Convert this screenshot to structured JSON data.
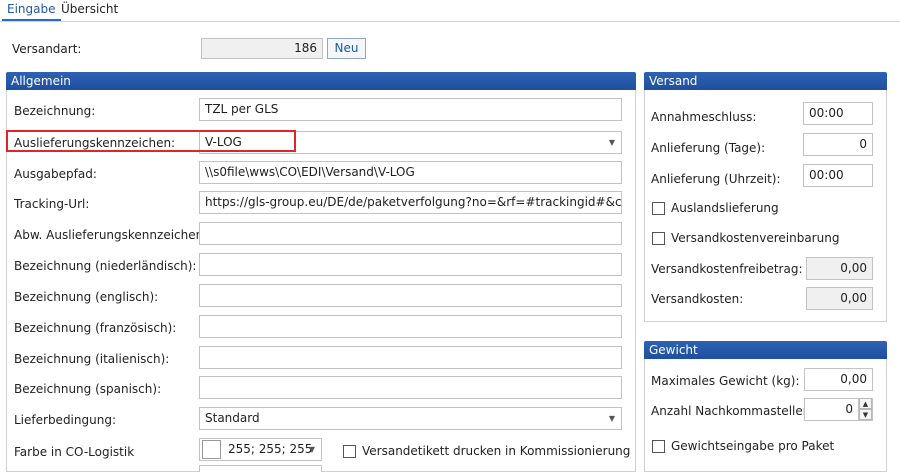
{
  "tabs": [
    {
      "label": "Eingabe"
    },
    {
      "label": "Übersicht"
    }
  ],
  "versandart": {
    "label": "Versandart:",
    "value": "186",
    "neu_button": "Neu"
  },
  "allgemein": {
    "header": "Allgemein",
    "rows": [
      {
        "label": "Bezeichnung:",
        "value": "TZL per GLS"
      },
      {
        "label": "Auslieferungskennzeichen:",
        "value": "V-LOG"
      },
      {
        "label": "Ausgabepfad:",
        "value": "\\\\s0file\\wws\\CO\\EDI\\Versand\\V-LOG"
      },
      {
        "label": "Tracking-Url:",
        "value": "https://gls-group.eu/DE/de/paketverfolgung?no=&rf=#trackingid#&crf=&l"
      },
      {
        "label": "Abw. Auslieferungskennzeichen:",
        "value": ""
      },
      {
        "label": "Bezeichnung (niederländisch):",
        "value": ""
      },
      {
        "label": "Bezeichnung (englisch):",
        "value": ""
      },
      {
        "label": "Bezeichnung (französisch):",
        "value": ""
      },
      {
        "label": "Bezeichnung (italienisch):",
        "value": ""
      },
      {
        "label": "Bezeichnung (spanisch):",
        "value": ""
      },
      {
        "label": "Lieferbedingung:",
        "value": "Standard"
      },
      {
        "label": "Farbe in CO-Logistik",
        "value": "255; 255; 255"
      }
    ],
    "versandetikett_label": "Versandetikett drucken in Kommissionierung"
  },
  "versand": {
    "header": "Versand",
    "annahmeschluss": {
      "label": "Annahmeschluss:",
      "value": "00:00"
    },
    "anlieferung_tage": {
      "label": "Anlieferung (Tage):",
      "value": "0"
    },
    "anlieferung_uhrzeit": {
      "label": "Anlieferung (Uhrzeit):",
      "value": "00:00"
    },
    "auslandslieferung": {
      "label": "Auslandslieferung",
      "checked": false
    },
    "versandkostenvereinbarung": {
      "label": "Versandkostenvereinbarung",
      "checked": false
    },
    "versandkostenfreibetrag": {
      "label": "Versandkostenfreibetrag:",
      "value": "0,00"
    },
    "versandkosten": {
      "label": "Versandkosten:",
      "value": "0,00"
    }
  },
  "gewicht": {
    "header": "Gewicht",
    "max_gewicht": {
      "label": "Maximales Gewicht (kg):",
      "value": "0,00"
    },
    "nachkommastellen": {
      "label": "Anzahl Nachkommastellen:",
      "value": "0"
    },
    "gewichtseingabe": {
      "label": "Gewichtseingabe pro Paket",
      "checked": false
    }
  },
  "colors": {
    "header": "#2a5cae",
    "highlight": "#e0242a",
    "tab_active": "#1e5aa8"
  }
}
